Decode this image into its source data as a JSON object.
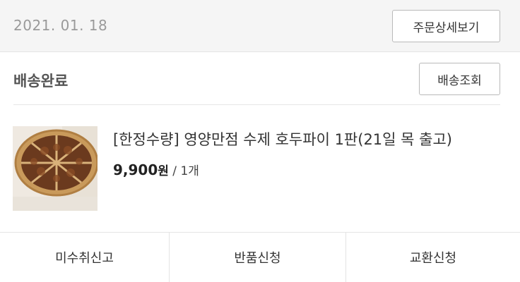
{
  "order": {
    "date": "2021. 01. 18",
    "detail_button": "주문상세보기"
  },
  "delivery": {
    "status": "배송완료",
    "track_button": "배송조회"
  },
  "product": {
    "image_icon": "pecan-pie-photo",
    "title": "[한정수량] 영양만점 수제 호두파이 1판(21일 목 출고)",
    "price": "9,900",
    "price_unit": "원",
    "quantity": " / 1개"
  },
  "actions": {
    "report_missing": "미수취신고",
    "return": "반품신청",
    "exchange": "교환신청"
  }
}
